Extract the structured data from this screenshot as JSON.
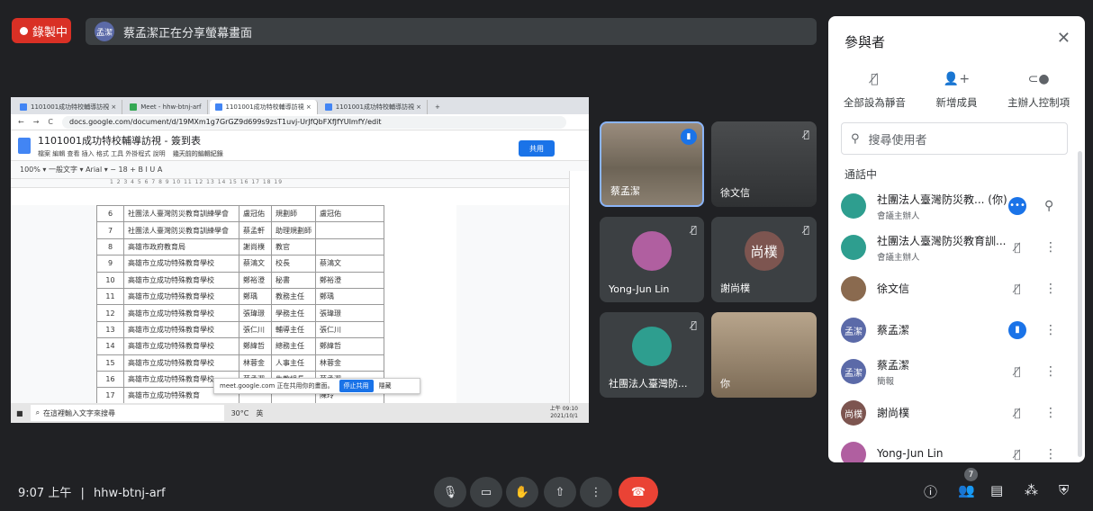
{
  "recording": {
    "label": "錄製中"
  },
  "presenting": {
    "avatar_text": "孟潔",
    "text": "蔡孟潔正在分享螢幕畫面"
  },
  "shared_screen": {
    "tabs": [
      "1101001成功特校輔導訪視 ×",
      "Meet - hhw-btnj-arf",
      "1101001成功特校輔導訪視 ×",
      "1101001成功特校輔導訪視 ×",
      "+"
    ],
    "url": "docs.google.com/document/d/19MXm1g7GrGZ9d699s9zsT1uvj-UrJfQbFXfJfYUImfY/edit",
    "doc_title": "1101001成功特校輔導訪視 - 簽到表",
    "doc_menu": "檔案  編輯  查看  插入  格式  工具  外掛程式  說明",
    "doc_menu_tail": "幾天前的編輯紀錄",
    "share_label": "共用",
    "toolbar": "100%  ▾  一般文字  ▾  Arial  ▾  −  18  +  B  I  U  A",
    "ruler": "1  2  3  4  5  6  7  8  9  10  11  12  13  14  15  16  17  18  19",
    "rows": [
      {
        "num": "6",
        "org": "社團法人臺灣防災教育訓練學會",
        "name": "盧冠佑",
        "title": "規劃師",
        "sign": "盧冠佑"
      },
      {
        "num": "7",
        "org": "社團法人臺灣防災教育訓練學會",
        "name": "蔡孟軒",
        "title": "助理規劃師",
        "sign": ""
      },
      {
        "num": "8",
        "org": "高雄市政府教育局",
        "name": "謝尚樸",
        "title": "教官",
        "sign": ""
      },
      {
        "num": "9",
        "org": "高雄市立成功特殊教育學校",
        "name": "蔡鴻文",
        "title": "校長",
        "sign": "蔡鴻文"
      },
      {
        "num": "10",
        "org": "高雄市立成功特殊教育學校",
        "name": "鄭裕澄",
        "title": "秘書",
        "sign": "鄭裕澄"
      },
      {
        "num": "11",
        "org": "高雄市立成功特殊教育學校",
        "name": "鄭瑀",
        "title": "教務主任",
        "sign": "鄭瑀"
      },
      {
        "num": "12",
        "org": "高雄市立成功特殊教育學校",
        "name": "張瑋璟",
        "title": "學務主任",
        "sign": "張瑋璟"
      },
      {
        "num": "13",
        "org": "高雄市立成功特殊教育學校",
        "name": "張仁川",
        "title": "輔導主任",
        "sign": "張仁川"
      },
      {
        "num": "14",
        "org": "高雄市立成功特殊教育學校",
        "name": "鄭緯哲",
        "title": "總務主任",
        "sign": "鄭緯哲"
      },
      {
        "num": "15",
        "org": "高雄市立成功特殊教育學校",
        "name": "林蓉金",
        "title": "人事主任",
        "sign": "林蓉金"
      },
      {
        "num": "16",
        "org": "高雄市立成功特殊教育學校",
        "name": "蔡孟潔",
        "title": "生教組長",
        "sign": "蔡孟潔"
      },
      {
        "num": "17",
        "org": "高雄市立成功特殊教育",
        "name": "",
        "title": "",
        "sign": "陳玲"
      }
    ],
    "popup": {
      "text": "meet.google.com 正在共用你的畫面。",
      "stop": "停止共用",
      "hide": "隱藏"
    },
    "taskbar": {
      "search": "在這裡輸入文字來搜尋",
      "temp": "30°C",
      "lang": "英",
      "time": "上午 09:10",
      "date": "2021/10/1"
    }
  },
  "tiles": [
    {
      "name": "蔡孟潔"
    },
    {
      "name": "徐文信"
    },
    {
      "name": "Yong-Jun Lin"
    },
    {
      "name": "謝尚樸",
      "avatar_text": "尚樸"
    },
    {
      "name": "社團法人臺灣防..."
    },
    {
      "name": "你"
    }
  ],
  "panel": {
    "title": "參與者",
    "actions": [
      {
        "label": "全部設為靜音"
      },
      {
        "label": "新增成員"
      },
      {
        "label": "主辦人控制項"
      }
    ],
    "search_placeholder": "搜尋使用者",
    "section": "通話中",
    "participants": [
      {
        "name": "社團法人臺灣防災教... (你)",
        "sub": "會議主辦人",
        "avatar_text": "",
        "color": "#2e9e8f"
      },
      {
        "name": "社團法人臺灣防災教育訓...",
        "sub": "會議主辦人",
        "avatar_text": "",
        "color": "#2e9e8f"
      },
      {
        "name": "徐文信",
        "sub": "",
        "avatar_text": "",
        "color": "#8a6a4f"
      },
      {
        "name": "蔡孟潔",
        "sub": "",
        "avatar_text": "孟潔",
        "color": "#5b6aa8"
      },
      {
        "name": "蔡孟潔",
        "sub": "簡報",
        "avatar_text": "孟潔",
        "color": "#5b6aa8"
      },
      {
        "name": "謝尚樸",
        "sub": "",
        "avatar_text": "尚樸",
        "color": "#7d5550"
      },
      {
        "name": "Yong-Jun Lin",
        "sub": "",
        "avatar_text": "",
        "color": "#b05fa0"
      }
    ]
  },
  "bottom": {
    "time": "9:07 上午",
    "separator": "|",
    "meeting_code": "hhw-btnj-arf",
    "participant_count": "7"
  }
}
